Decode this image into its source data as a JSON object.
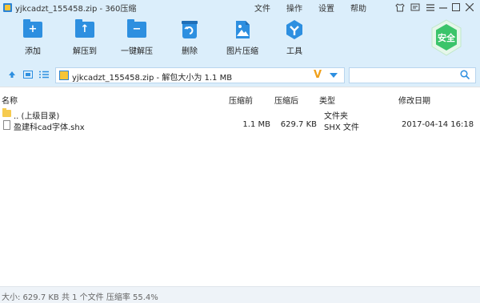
{
  "window": {
    "title": "yjkcadzt_155458.zip - 360压缩",
    "menu": [
      "文件",
      "操作",
      "设置",
      "帮助"
    ]
  },
  "toolbar": {
    "buttons": [
      {
        "label": "添加",
        "icon": "add-icon"
      },
      {
        "label": "解压到",
        "icon": "extract-to-icon"
      },
      {
        "label": "一键解压",
        "icon": "one-click-extract-icon"
      },
      {
        "label": "删除",
        "icon": "delete-icon"
      },
      {
        "label": "图片压缩",
        "icon": "image-compress-icon"
      },
      {
        "label": "工具",
        "icon": "tools-icon"
      }
    ],
    "security_badge": "安全"
  },
  "address": {
    "text": "yjkcadzt_155458.zip - 解包大小为 1.1 MB",
    "logo": "V",
    "search_placeholder": ""
  },
  "columns": {
    "name": "名称",
    "packed": "压缩前",
    "compressed": "压缩后",
    "type": "类型",
    "modified": "修改日期"
  },
  "rows": [
    {
      "name": ".. (上级目录)",
      "packed": "",
      "compressed": "",
      "type": "文件夹",
      "modified": ""
    },
    {
      "name": "盈建科cad字体.shx",
      "packed": "1.1 MB",
      "compressed": "629.7 KB",
      "type": "SHX 文件",
      "modified": "2017-04-14 16:18"
    }
  ],
  "status": {
    "text": "大小: 629.7 KB 共 1 个文件 压缩率 55.4%"
  },
  "colors": {
    "chrome_bg": "#dbeefb",
    "accent": "#2d8fe0",
    "security": "#3bc46a"
  }
}
